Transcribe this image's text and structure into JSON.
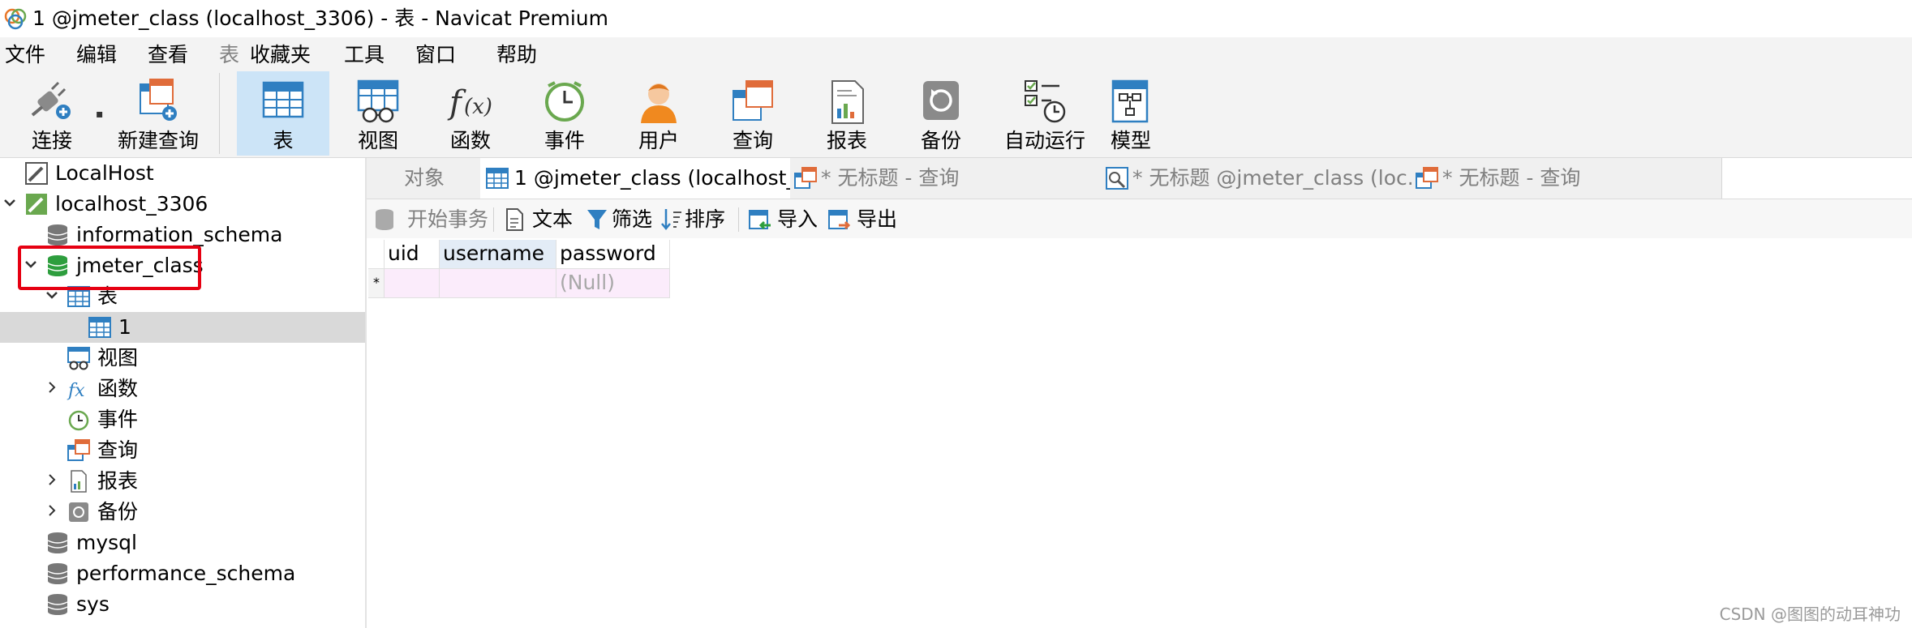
{
  "window": {
    "title": "1 @jmeter_class (localhost_3306) - 表 - Navicat Premium"
  },
  "menu": [
    "文件",
    "编辑",
    "查看",
    "表",
    "收藏夹",
    "工具",
    "窗口",
    "帮助"
  ],
  "toolbar": {
    "connect": "连接",
    "new_query": "新建查询",
    "table": "表",
    "view": "视图",
    "function": "函数",
    "event": "事件",
    "user": "用户",
    "query": "查询",
    "report": "报表",
    "backup": "备份",
    "automation": "自动运行",
    "model": "模型"
  },
  "sidebar": {
    "items": [
      {
        "label": "LocalHost"
      },
      {
        "label": "localhost_3306"
      },
      {
        "label": "information_schema"
      },
      {
        "label": "jmeter_class"
      },
      {
        "label": "表"
      },
      {
        "label": "1"
      },
      {
        "label": "视图"
      },
      {
        "label": "函数"
      },
      {
        "label": "事件"
      },
      {
        "label": "查询"
      },
      {
        "label": "报表"
      },
      {
        "label": "备份"
      },
      {
        "label": "mysql"
      },
      {
        "label": "performance_schema"
      },
      {
        "label": "sys"
      }
    ]
  },
  "tabs": [
    {
      "label": "对象"
    },
    {
      "label": "1 @jmeter_class (localhost_..."
    },
    {
      "label": "* 无标题 - 查询"
    },
    {
      "label": "* 无标题 @jmeter_class (loc..."
    },
    {
      "label": "* 无标题 - 查询"
    }
  ],
  "subtoolbar": {
    "begin_transaction": "开始事务",
    "text": "文本",
    "filter": "筛选",
    "sort": "排序",
    "import": "导入",
    "export": "导出"
  },
  "grid": {
    "columns": [
      "uid",
      "username",
      "password"
    ],
    "new_row_marker": "*",
    "new_row_values": [
      "",
      "",
      "(Null)"
    ]
  },
  "watermark": "CSDN @图图的动耳神功",
  "colors": {
    "highlight": "#e60012",
    "active_toolbar": "#cce4f7",
    "selected_tree_row": "#d9d9d9"
  }
}
